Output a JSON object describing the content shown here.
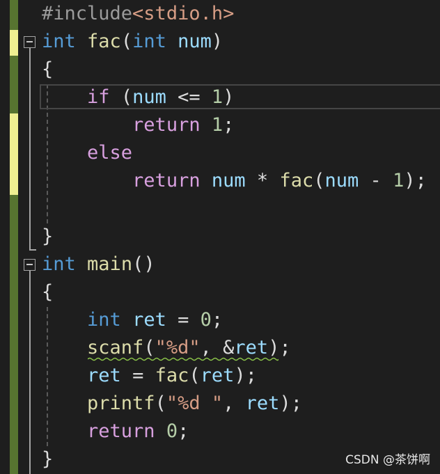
{
  "editor": {
    "lines": {
      "l1": {
        "hash": "#include",
        "header": "<stdio.h>"
      },
      "l2": {
        "type": "int",
        "name": "fac",
        "open": "(",
        "ptype": "int",
        "param": "num",
        "close": ")"
      },
      "l3": {
        "brace": "{"
      },
      "l4": {
        "kw": "if",
        "open": "(",
        "var": "num",
        "op": "<=",
        "num": "1",
        "close": ")"
      },
      "l5": {
        "kw": "return",
        "num": "1",
        "semi": ";"
      },
      "l6": {
        "kw": "else"
      },
      "l7": {
        "kw": "return",
        "var": "num",
        "op": "*",
        "fn": "fac",
        "open": "(",
        "var2": "num",
        "op2": "-",
        "num": "1",
        "close": ");"
      },
      "l9": {
        "brace": "}"
      },
      "l10": {
        "type": "int",
        "name": "main",
        "parens": "()"
      },
      "l11": {
        "brace": "{"
      },
      "l12": {
        "type": "int",
        "var": "ret",
        "op": "=",
        "num": "0",
        "semi": ";"
      },
      "l13": {
        "fn": "scanf",
        "open": "(",
        "str": "\"%d\"",
        "comma": ",",
        "amp": "&",
        "var": "ret",
        "close": ");"
      },
      "l14": {
        "var": "ret",
        "op": "=",
        "fn": "fac",
        "open": "(",
        "var2": "ret",
        "close": ");"
      },
      "l15": {
        "fn": "printf",
        "open": "(",
        "str": "\"%d \"",
        "comma": ",",
        "var": "ret",
        "close": ");"
      },
      "l16": {
        "kw": "return",
        "num": "0",
        "semi": ";"
      },
      "l17": {
        "brace": "}"
      }
    }
  },
  "watermark": "CSDN @茶饼啊",
  "colors": {
    "background": "#1e1e1e",
    "keyword_blue": "#569cd6",
    "keyword_purple": "#d8a0df",
    "function": "#dcdcaa",
    "variable": "#9cdcfe",
    "number": "#b5cea8",
    "string": "#d69d85",
    "margin_saved": "#577430",
    "margin_unsaved": "#efef91"
  }
}
